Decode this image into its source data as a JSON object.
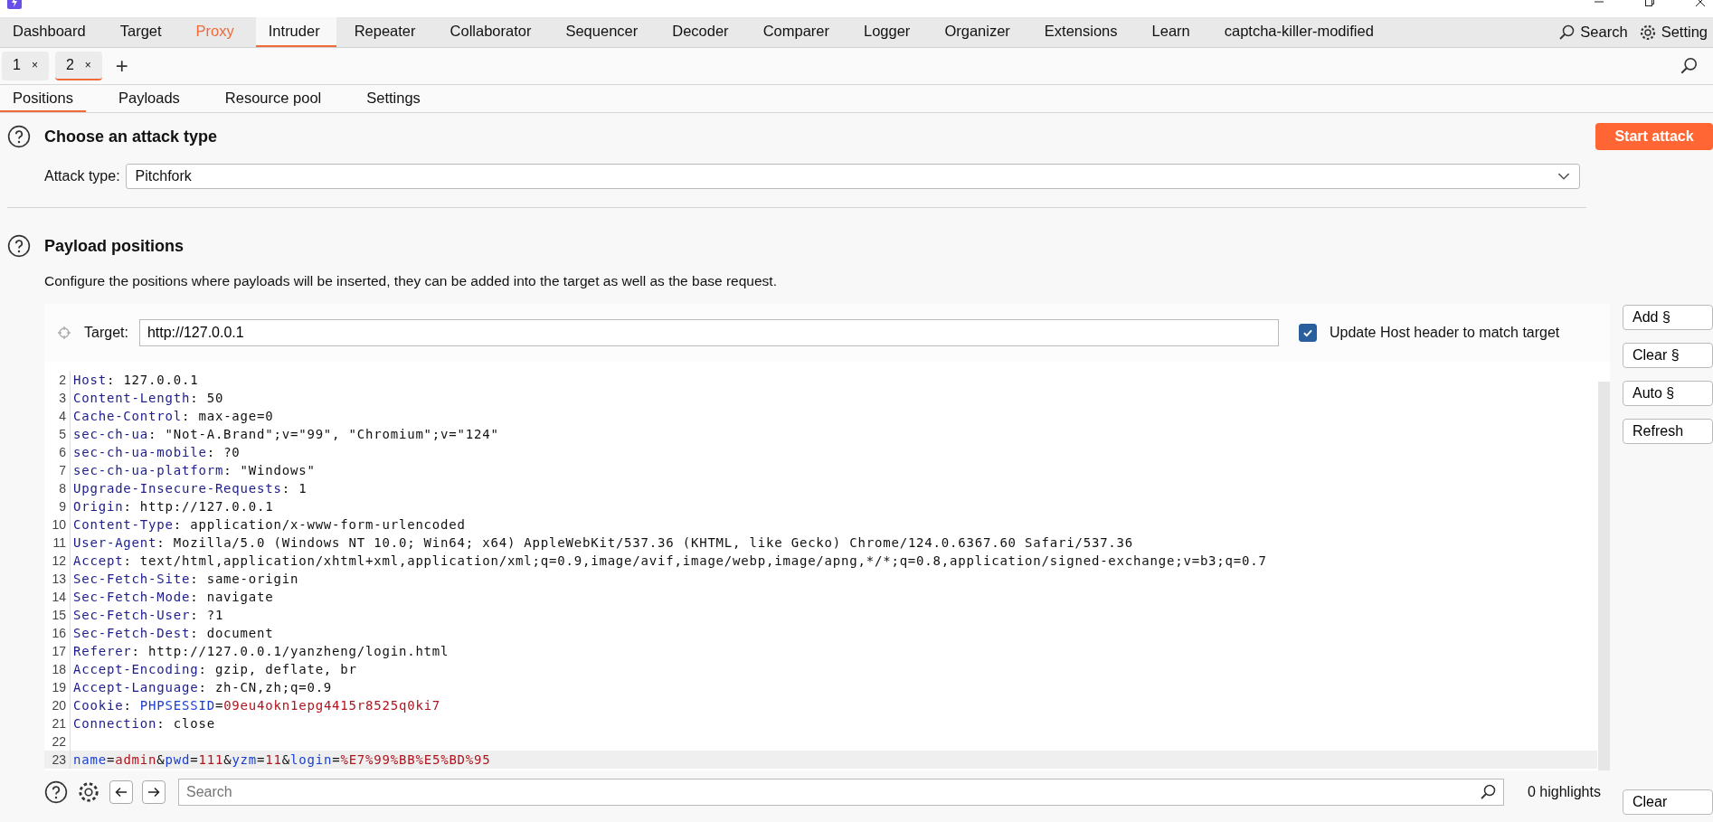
{
  "main_tabs": [
    {
      "label": "Dashboard",
      "selected": false,
      "highlighted": false
    },
    {
      "label": "Target",
      "selected": false,
      "highlighted": false
    },
    {
      "label": "Proxy",
      "selected": false,
      "highlighted": true
    },
    {
      "label": "Intruder",
      "selected": true,
      "highlighted": false
    },
    {
      "label": "Repeater",
      "selected": false,
      "highlighted": false
    },
    {
      "label": "Collaborator",
      "selected": false,
      "highlighted": false
    },
    {
      "label": "Sequencer",
      "selected": false,
      "highlighted": false
    },
    {
      "label": "Decoder",
      "selected": false,
      "highlighted": false
    },
    {
      "label": "Comparer",
      "selected": false,
      "highlighted": false
    },
    {
      "label": "Logger",
      "selected": false,
      "highlighted": false
    },
    {
      "label": "Organizer",
      "selected": false,
      "highlighted": false
    },
    {
      "label": "Extensions",
      "selected": false,
      "highlighted": false
    },
    {
      "label": "Learn",
      "selected": false,
      "highlighted": false
    },
    {
      "label": "captcha-killer-modified",
      "selected": false,
      "highlighted": false
    }
  ],
  "top_actions": [
    "Search",
    "Setting"
  ],
  "attack_tabs": [
    {
      "label": "1",
      "close": "×",
      "selected": false
    },
    {
      "label": "2",
      "close": "×",
      "selected": true
    }
  ],
  "add_tab": "+",
  "sub_tabs": [
    {
      "label": "Positions",
      "selected": true
    },
    {
      "label": "Payloads",
      "selected": false
    },
    {
      "label": "Resource pool",
      "selected": false
    },
    {
      "label": "Settings",
      "selected": false
    }
  ],
  "attack_type_section": {
    "heading": "Choose an attack type",
    "start_button": "Start attack",
    "label": "Attack type:",
    "value": "Pitchfork"
  },
  "payload_positions": {
    "heading": "Payload positions",
    "description": "Configure the positions where payloads will be inserted, they can be added into the target as well as the base request.",
    "target_label": "Target:",
    "target_value": "http://127.0.0.1",
    "update_host": {
      "label": "Update Host header to match target",
      "checked": true
    },
    "side_buttons": [
      "Add §",
      "Clear §",
      "Auto §",
      "Refresh"
    ],
    "lines": [
      {
        "number": "2",
        "current": false,
        "segments": [
          {
            "kind": "header",
            "text": "Host"
          },
          {
            "kind": "text",
            "text": ": 127.0.0.1"
          }
        ]
      },
      {
        "number": "3",
        "current": false,
        "segments": [
          {
            "kind": "header",
            "text": "Content-Length"
          },
          {
            "kind": "text",
            "text": ": 50"
          }
        ]
      },
      {
        "number": "4",
        "current": false,
        "segments": [
          {
            "kind": "header",
            "text": "Cache-Control"
          },
          {
            "kind": "text",
            "text": ": max-age=0"
          }
        ]
      },
      {
        "number": "5",
        "current": false,
        "segments": [
          {
            "kind": "header",
            "text": "sec-ch-ua"
          },
          {
            "kind": "text",
            "text": ": \"Not-A.Brand\";v=\"99\", \"Chromium\";v=\"124\""
          }
        ]
      },
      {
        "number": "6",
        "current": false,
        "segments": [
          {
            "kind": "header",
            "text": "sec-ch-ua-mobile"
          },
          {
            "kind": "text",
            "text": ": ?0"
          }
        ]
      },
      {
        "number": "7",
        "current": false,
        "segments": [
          {
            "kind": "header",
            "text": "sec-ch-ua-platform"
          },
          {
            "kind": "text",
            "text": ": \"Windows\""
          }
        ]
      },
      {
        "number": "8",
        "current": false,
        "segments": [
          {
            "kind": "header",
            "text": "Upgrade-Insecure-Requests"
          },
          {
            "kind": "text",
            "text": ": 1"
          }
        ]
      },
      {
        "number": "9",
        "current": false,
        "segments": [
          {
            "kind": "header",
            "text": "Origin"
          },
          {
            "kind": "text",
            "text": ": http://127.0.0.1"
          }
        ]
      },
      {
        "number": "10",
        "current": false,
        "segments": [
          {
            "kind": "header",
            "text": "Content-Type"
          },
          {
            "kind": "text",
            "text": ": application/x-www-form-urlencoded"
          }
        ]
      },
      {
        "number": "11",
        "current": false,
        "segments": [
          {
            "kind": "header",
            "text": "User-Agent"
          },
          {
            "kind": "text",
            "text": ": Mozilla/5.0 (Windows NT 10.0; Win64; x64) AppleWebKit/537.36 (KHTML, like Gecko) Chrome/124.0.6367.60 Safari/537.36"
          }
        ]
      },
      {
        "number": "12",
        "current": false,
        "segments": [
          {
            "kind": "header",
            "text": "Accept"
          },
          {
            "kind": "text",
            "text": ": text/html,application/xhtml+xml,application/xml;q=0.9,image/avif,image/webp,image/apng,*/*;q=0.8,application/signed-exchange;v=b3;q=0.7"
          }
        ]
      },
      {
        "number": "13",
        "current": false,
        "segments": [
          {
            "kind": "header",
            "text": "Sec-Fetch-Site"
          },
          {
            "kind": "text",
            "text": ": same-origin"
          }
        ]
      },
      {
        "number": "14",
        "current": false,
        "segments": [
          {
            "kind": "header",
            "text": "Sec-Fetch-Mode"
          },
          {
            "kind": "text",
            "text": ": navigate"
          }
        ]
      },
      {
        "number": "15",
        "current": false,
        "segments": [
          {
            "kind": "header",
            "text": "Sec-Fetch-User"
          },
          {
            "kind": "text",
            "text": ": ?1"
          }
        ]
      },
      {
        "number": "16",
        "current": false,
        "segments": [
          {
            "kind": "header",
            "text": "Sec-Fetch-Dest"
          },
          {
            "kind": "text",
            "text": ": document"
          }
        ]
      },
      {
        "number": "17",
        "current": false,
        "segments": [
          {
            "kind": "header",
            "text": "Referer"
          },
          {
            "kind": "text",
            "text": ": http://127.0.0.1/yanzheng/login.html"
          }
        ]
      },
      {
        "number": "18",
        "current": false,
        "segments": [
          {
            "kind": "header",
            "text": "Accept-Encoding"
          },
          {
            "kind": "text",
            "text": ": gzip, deflate, br"
          }
        ]
      },
      {
        "number": "19",
        "current": false,
        "segments": [
          {
            "kind": "header",
            "text": "Accept-Language"
          },
          {
            "kind": "text",
            "text": ": zh-CN,zh;q=0.9"
          }
        ]
      },
      {
        "number": "20",
        "current": false,
        "segments": [
          {
            "kind": "header",
            "text": "Cookie"
          },
          {
            "kind": "text",
            "text": ": "
          },
          {
            "kind": "param",
            "text": "PHPSESSID"
          },
          {
            "kind": "text",
            "text": "="
          },
          {
            "kind": "value",
            "text": "09eu4okn1epg4415r8525q0ki7"
          }
        ]
      },
      {
        "number": "21",
        "current": false,
        "segments": [
          {
            "kind": "header",
            "text": "Connection"
          },
          {
            "kind": "text",
            "text": ": close"
          }
        ]
      },
      {
        "number": "22",
        "current": false
      },
      {
        "number": "23",
        "current": true,
        "segments": [
          {
            "kind": "param",
            "text": "name"
          },
          {
            "kind": "text",
            "text": "="
          },
          {
            "kind": "value",
            "text": "admin"
          },
          {
            "kind": "text",
            "text": "&"
          },
          {
            "kind": "param",
            "text": "pwd"
          },
          {
            "kind": "text",
            "text": "="
          },
          {
            "kind": "value",
            "text": "111"
          },
          {
            "kind": "text",
            "text": "&"
          },
          {
            "kind": "param",
            "text": "yzm"
          },
          {
            "kind": "text",
            "text": "="
          },
          {
            "kind": "value",
            "text": "11"
          },
          {
            "kind": "text",
            "text": "&"
          },
          {
            "kind": "param",
            "text": "login"
          },
          {
            "kind": "text",
            "text": "="
          },
          {
            "kind": "value",
            "text": "%E7%99%BB%E5%BD%95"
          }
        ]
      }
    ],
    "search": {
      "placeholder": "Search",
      "highlights": "0 highlights",
      "clear_button": "Clear"
    }
  }
}
